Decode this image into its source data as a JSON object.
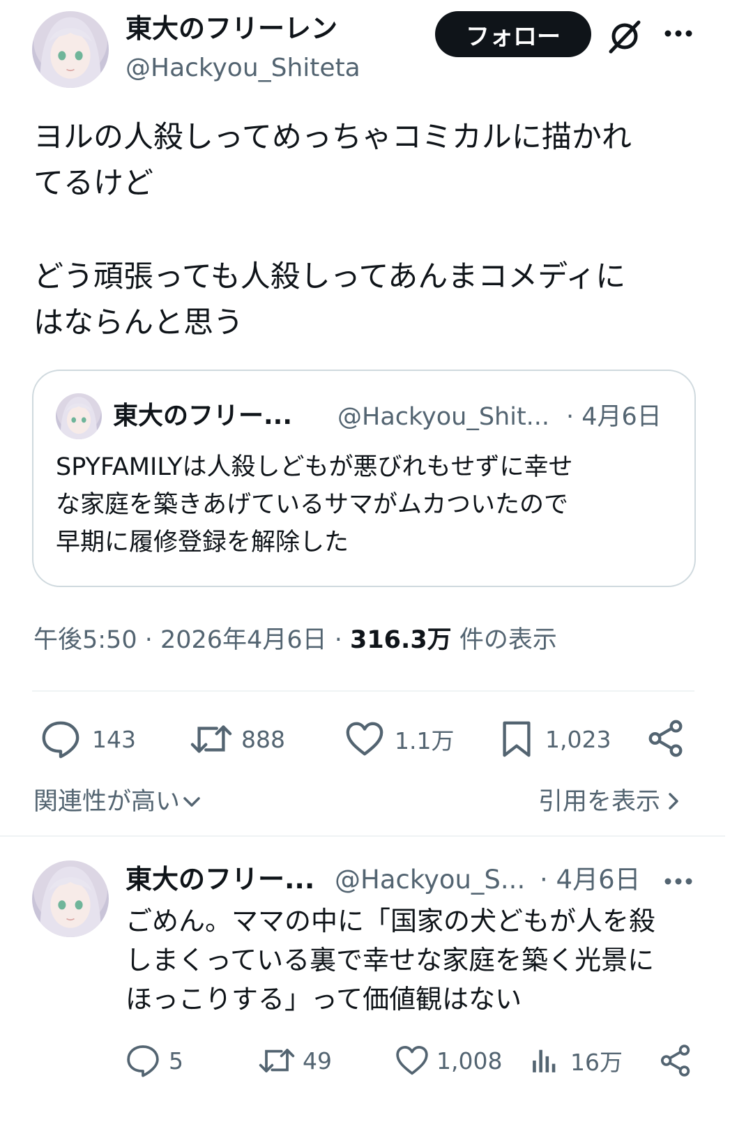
{
  "main_tweet": {
    "author_name": "東大のフリーレン",
    "author_handle": "@Hackyou_Shiteta",
    "follow_label": "フォロー",
    "text": "ヨルの人殺しってめっちゃコミカルに描かれてるけど\n\nどう頑張っても人殺しってあんまコメディにはならんと思う",
    "text_line_1": "ヨルの人殺しってめっちゃコミカルに描かれ",
    "text_line_2": "てるけど",
    "text_line_3": "どう頑張っても人殺しってあんまコメディに",
    "text_line_4": "はならんと思う",
    "timestamp": "午後5:50 · 2026年4月6日 · ",
    "views_count": "316.3万",
    "views_label": " 件の表示",
    "actions": {
      "replies": "143",
      "retweets": "888",
      "likes": "1.1万",
      "bookmarks": "1,023"
    },
    "sort_label": "関連性が高い",
    "quotes_link": "引用を表示"
  },
  "quoted_tweet": {
    "author_name": "東大のフリー...",
    "author_handle": "@Hackyou_Shit...",
    "date": "· 4月6日",
    "text_line_1": "SPYFAMILYは人殺しどもが悪びれもせずに幸せ",
    "text_line_2": "な家庭を築きあげているサマがムカついたので",
    "text_line_3": "早期に履修登録を解除した"
  },
  "reply": {
    "author_name": "東大のフリー...",
    "author_handle": "@Hackyou_S...",
    "date": "· 4月6日",
    "text_line_1": "ごめん。ママの中に「国家の犬どもが人を殺",
    "text_line_2": "しまくっている裏で幸せな家庭を築く光景に",
    "text_line_3": "ほっこりする」って価値観はない",
    "actions": {
      "replies": "5",
      "retweets": "49",
      "likes": "1,008",
      "views": "16万"
    }
  },
  "icons": [
    "grok-icon",
    "more-icon",
    "reply-icon",
    "retweet-icon",
    "like-icon",
    "bookmark-icon",
    "share-icon",
    "views-icon",
    "chevron-down-icon",
    "chevron-right-icon"
  ],
  "colors": {
    "text": "#0f1419",
    "muted": "#536471",
    "border": "#cfd9de",
    "button": "#0f1419"
  }
}
